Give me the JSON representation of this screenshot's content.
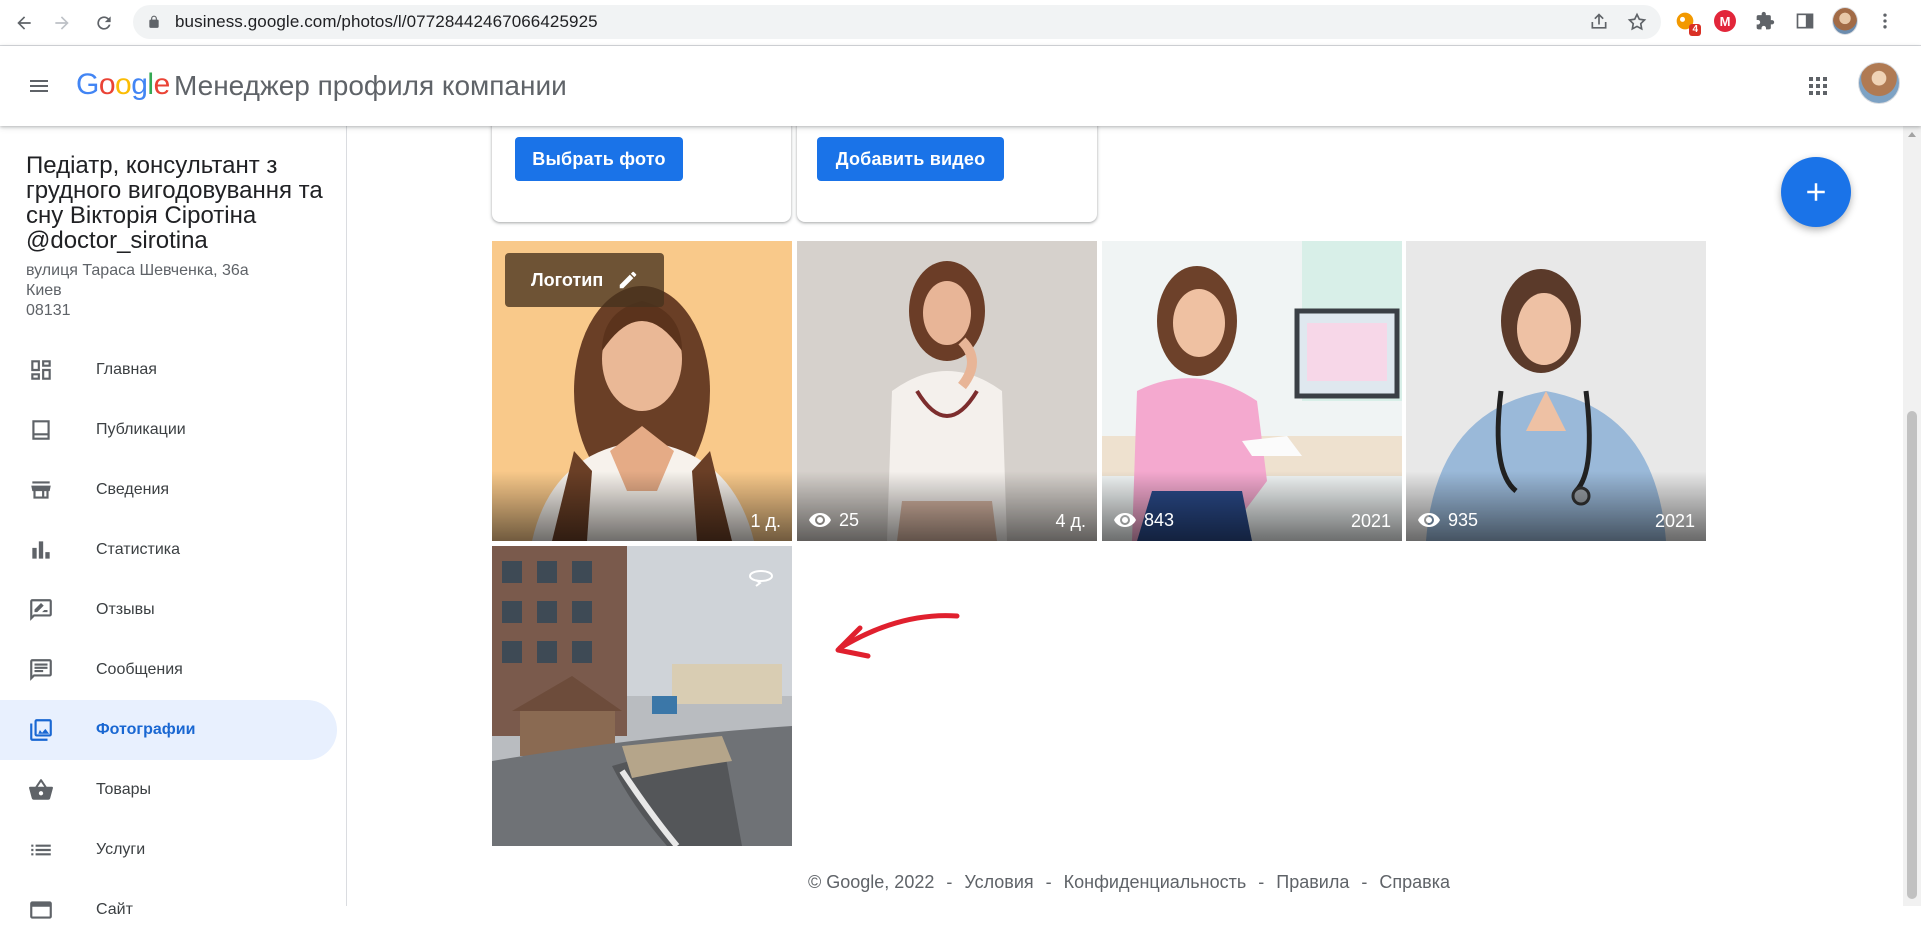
{
  "browser": {
    "url": "business.google.com/photos/l/07728442467066425925",
    "extension_badge": "4",
    "extension_m_label": "M"
  },
  "header": {
    "logo_letters": [
      "G",
      "o",
      "o",
      "g",
      "l",
      "e"
    ],
    "title": "Менеджер профиля компании"
  },
  "business": {
    "name": "Педіатр, консультант з грудного вигодовування та сну Вікторія Сіротіна @doctor_sirotina",
    "address_line1": "вулиця Тараса Шевченка, 36а",
    "address_line2": "Киев",
    "address_line3": "08131"
  },
  "sidebar": {
    "items": [
      {
        "label": "Главная",
        "icon": "dashboard-icon"
      },
      {
        "label": "Публикации",
        "icon": "posts-icon"
      },
      {
        "label": "Сведения",
        "icon": "store-icon"
      },
      {
        "label": "Статистика",
        "icon": "bar-chart-icon"
      },
      {
        "label": "Отзывы",
        "icon": "rate-review-icon"
      },
      {
        "label": "Сообщения",
        "icon": "message-icon"
      },
      {
        "label": "Фотографии",
        "icon": "photo-library-icon",
        "active": true
      },
      {
        "label": "Товары",
        "icon": "basket-icon"
      },
      {
        "label": "Услуги",
        "icon": "list-icon"
      },
      {
        "label": "Сайт",
        "icon": "web-icon"
      }
    ]
  },
  "main": {
    "choose_photo_label": "Выбрать фото",
    "add_video_label": "Добавить видео",
    "logo_chip_label": "Логотип",
    "photos": [
      {
        "views": "",
        "age": "1 д."
      },
      {
        "views": "25",
        "age": "4 д."
      },
      {
        "views": "843",
        "age": "2021"
      },
      {
        "views": "935",
        "age": "2021"
      }
    ]
  },
  "footer": {
    "copyright": "© Google, 2022",
    "terms": "Условия",
    "privacy": "Конфиденциальность",
    "policies": "Правила",
    "help": "Справка",
    "separator": "-"
  },
  "colors": {
    "accent": "#1a73e8",
    "active_bg": "#e8f0fe",
    "active_text": "#1967d2",
    "annotation_arrow": "#e0202e"
  }
}
